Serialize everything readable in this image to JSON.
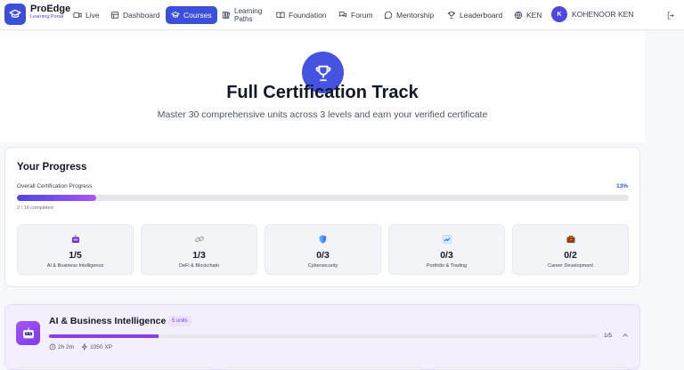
{
  "nav": {
    "brand_name": "ProEdge",
    "brand_sub": "Learning Portal",
    "items": [
      {
        "label": "Live",
        "icon": "video-icon"
      },
      {
        "label": "Dashboard",
        "icon": "dashboard-icon"
      },
      {
        "label": "Courses",
        "icon": "graduation-cap-icon",
        "active": true
      },
      {
        "label_line1": "Learning",
        "label_line2": "Paths",
        "icon": "books-icon"
      },
      {
        "label": "Foundation",
        "icon": "book-open-icon"
      },
      {
        "label": "Forum",
        "icon": "chat-bubbles-icon"
      },
      {
        "label": "Mentorship",
        "icon": "message-circle-icon"
      },
      {
        "label": "Leaderboard",
        "icon": "trophy-icon"
      },
      {
        "label": "KEN",
        "icon": "globe-icon"
      }
    ],
    "user": {
      "initial": "K",
      "name": "KOHENOOR KEN"
    }
  },
  "hero": {
    "title": "Full Certification Track",
    "subtitle": "Master 30 comprehensive units across 3 levels and earn your verified certificate"
  },
  "progress": {
    "title": "Your Progress",
    "overall_label": "Overall Certification Progress",
    "percent_label": "13%",
    "percent_value": 13,
    "completed_label": "2 / 16 completed",
    "levels": [
      {
        "count": "1/5",
        "name": "AI & Business Intelligence",
        "icon": "robot-icon"
      },
      {
        "count": "1/3",
        "name": "DeFi & Blockchain",
        "icon": "chain-link-icon"
      },
      {
        "count": "0/3",
        "name": "Cybersecurity",
        "icon": "shield-icon"
      },
      {
        "count": "0/3",
        "name": "Portfolio & Trading",
        "icon": "chart-up-icon"
      },
      {
        "count": "0/2",
        "name": "Career Development",
        "icon": "briefcase-icon"
      }
    ]
  },
  "course": {
    "title": "AI & Business Intelligence",
    "badge": "5 units",
    "progress_fraction": 0.2,
    "fraction_label": "1/5",
    "duration": "2h 2m",
    "xp": "1050 XP"
  },
  "colors": {
    "accent": "#3b4fd8",
    "purple": "#8b3fe3"
  }
}
